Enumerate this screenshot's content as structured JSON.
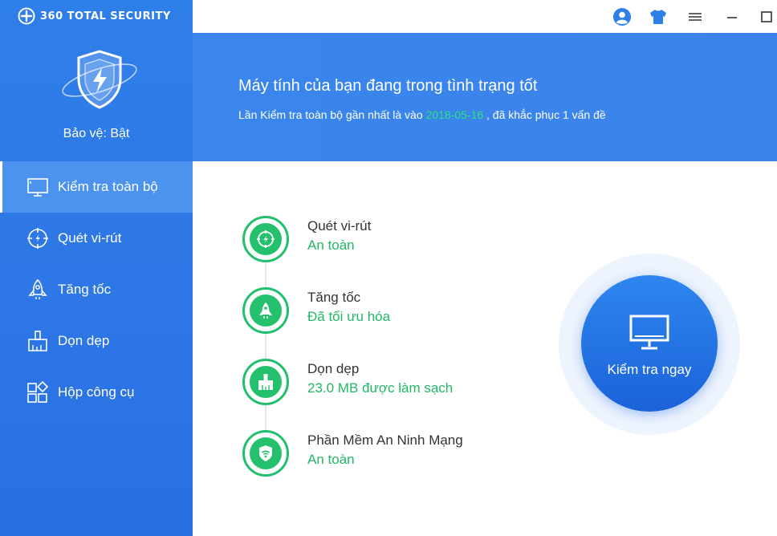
{
  "app": {
    "brand_name": "360 TOTAL SECURITY",
    "protection_label": "Bảo vệ: Bật"
  },
  "sidebar": {
    "items": [
      {
        "label": "Kiểm tra toàn bộ",
        "icon": "monitor-icon",
        "active": true
      },
      {
        "label": "Quét vi-rút",
        "icon": "virus-scan-icon",
        "active": false
      },
      {
        "label": "Tăng tốc",
        "icon": "rocket-icon",
        "active": false
      },
      {
        "label": "Dọn dẹp",
        "icon": "broom-icon",
        "active": false
      },
      {
        "label": "Hộp công cụ",
        "icon": "toolbox-icon",
        "active": false
      }
    ]
  },
  "titlebar": {
    "icons": [
      "user-icon",
      "skin-shirt-icon",
      "menu-icon",
      "minimize-icon",
      "maximize-icon"
    ]
  },
  "banner": {
    "title": "Máy tính của bạn đang trong tình trạng tốt",
    "sub_prefix": "Lần Kiểm tra toàn bộ gần nhất là vào",
    "sub_date": "2018-05-16",
    "sub_suffix": ", đã khắc phục 1 vấn đề"
  },
  "status": [
    {
      "title": "Quét vi-rút",
      "value": "An toàn",
      "icon": "virus-scan-icon"
    },
    {
      "title": "Tăng tốc",
      "value": "Đã tối ưu hóa",
      "icon": "rocket-icon"
    },
    {
      "title": "Dọn dẹp",
      "value": "23.0 MB được làm sạch",
      "icon": "broom-icon"
    },
    {
      "title": "Phần Mềm An Ninh Mạng",
      "value": "An toàn",
      "icon": "wifi-shield-icon"
    }
  ],
  "scan_button": {
    "label": "Kiểm tra ngay",
    "icon": "monitor-icon"
  },
  "colors": {
    "primary_blue": "#2f7fe8",
    "success_green": "#22bf6c",
    "date_green": "#2ae27a"
  }
}
